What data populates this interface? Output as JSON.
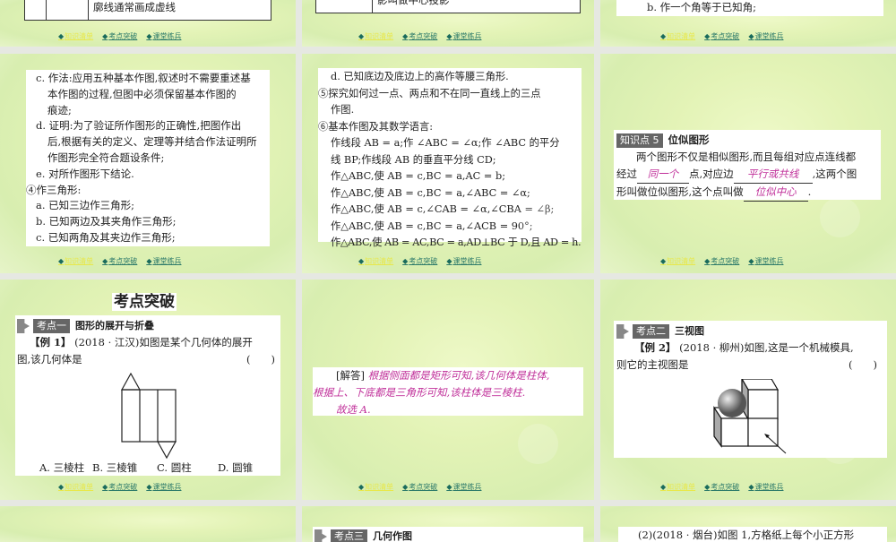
{
  "nav": {
    "knowledge": "知识清单",
    "breakthrough": "考点突破",
    "practice": "课堂练兵"
  },
  "s1": {
    "cell": "廓线通常画成虚线"
  },
  "s2": {
    "cell": "影叫做中心投影"
  },
  "s3": {
    "line": "b. 作一个角等于已知角;"
  },
  "s4": {
    "lines": [
      "c. 作法:应用五种基本作图,叙述时不需要重述基",
      "本作图的过程,但图中必须保留基本作图的",
      "痕迹;",
      "d. 证明:为了验证所作图形的正确性,把图作出",
      "后,根据有关的定义、定理等并结合作法证明所",
      "作图形完全符合题设条件;",
      "e. 对所作图形下结论.",
      "④作三角形:",
      "a. 已知三边作三角形;",
      "b. 已知两边及其夹角作三角形;",
      "c. 已知两角及其夹边作三角形;"
    ]
  },
  "s5": {
    "lines": [
      "d. 已知底边及底边上的高作等腰三角形.",
      "⑤探究如何过一点、两点和不在同一直线上的三点",
      "作图.",
      "⑥基本作图及其数学语言:",
      "作线段 AB = a;作 ∠ABC = ∠α;作 ∠ABC 的平分",
      "线 BP;作线段 AB 的垂直平分线 CD;",
      "作△ABC,使 AB = c,BC = a,AC = b;",
      "作△ABC,使 AB = c,BC = a,∠ABC = ∠α;",
      "作△ABC,使 AB = c,∠CAB = ∠α,∠CBA = ∠β;",
      "作△ABC,使 AB = c,BC = a,∠ACB = 90°;",
      "作△ABC,使 AB = AC,BC = a,AD⊥BC 于 D,且 AD = h."
    ]
  },
  "s6": {
    "tag": "知识点 5",
    "title": "位似图形",
    "t1": "两个图形不仅是相似图形,而且每组对应点连线都",
    "t2a": "经过",
    "b1": "同一个",
    "t2b": "点,对应边",
    "b2": "平行或共线",
    "t2c": ",这两个图",
    "t3a": "形叫做位似图形,这个点叫做",
    "b3": "位似中心",
    "t3b": "."
  },
  "s7": {
    "title": "考点突破",
    "tag": "考点一",
    "topic": "图形的展开与折叠",
    "ex": "【例 1】",
    "q1": "(2018 · 江汉)如图是某个几何体的展开",
    "q2": "图,该几何体是",
    "paren": "(　　)",
    "opts": [
      "A. 三棱柱",
      "B. 三棱锥",
      "C. 圆柱",
      "D. 圆锥"
    ]
  },
  "s8": {
    "label": "[解答]",
    "a1": "根据侧面都是矩形可知,该几何体是柱体,",
    "a2": "根据上、下底都是三角形可知,该柱体是三棱柱.",
    "a3": "故选 A."
  },
  "s9": {
    "tag": "考点二",
    "topic": "三视图",
    "ex": "【例 2】",
    "q1": "(2018 · 柳州)如图,这是一个机械模具,",
    "q2": "则它的主视图是",
    "paren": "(　　)"
  },
  "s10": {
    "tag": "考点三",
    "topic": "几何作图"
  },
  "s11": {
    "line": "(2)(2018 · 烟台)如图 1,方格纸上每个小正方形"
  }
}
